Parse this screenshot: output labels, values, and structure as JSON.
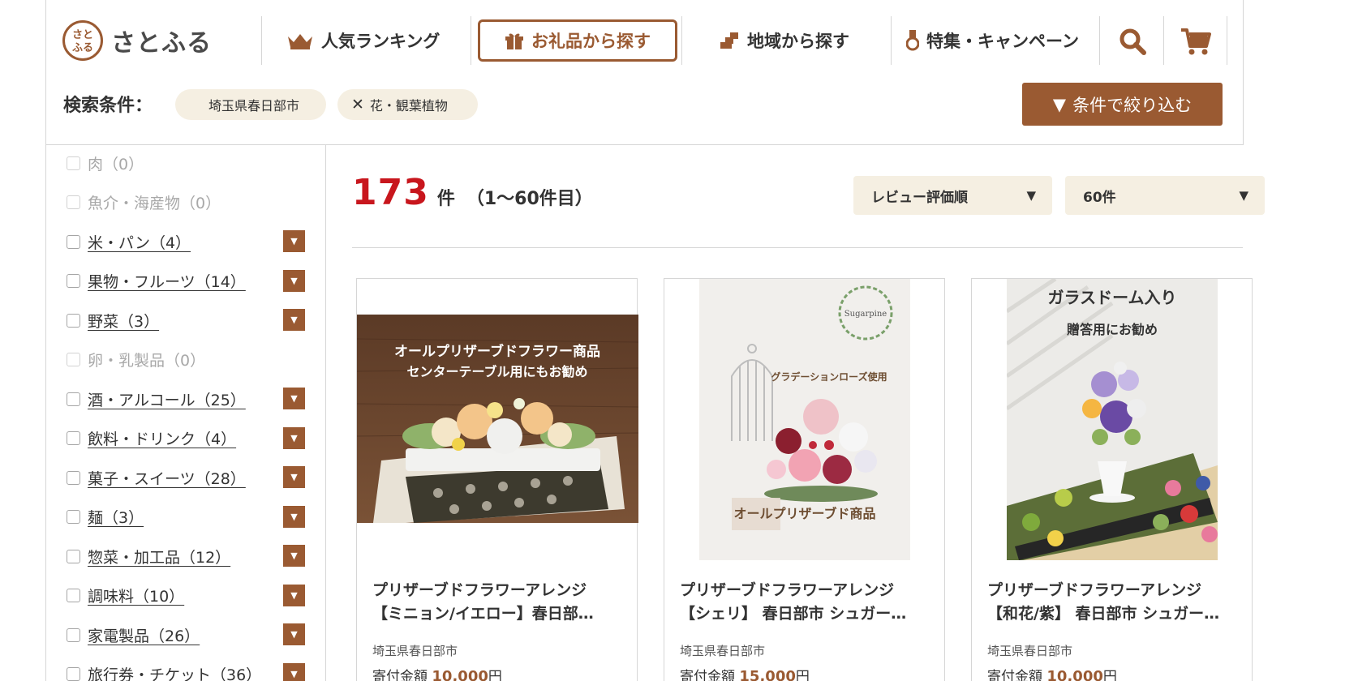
{
  "header": {
    "logo_mark": "さと\nふる",
    "logo_text": "さとふる",
    "nav": [
      {
        "label": "人気ランキング",
        "icon": "crown-icon"
      },
      {
        "label": "お礼品から探す",
        "icon": "gift-icon",
        "active": true
      },
      {
        "label": "地域から探す",
        "icon": "region-map-icon"
      },
      {
        "label": "特集・キャンペーン",
        "icon": "medal-icon"
      }
    ],
    "search_icon": "search-icon",
    "cart_icon": "cart-icon",
    "accent_color": "#9a5a32"
  },
  "conditions": {
    "label": "検索条件：",
    "chips": [
      {
        "label": "埼玉県春日部市",
        "removable": false
      },
      {
        "label": "花・観葉植物",
        "removable": true,
        "remove_glyph": "✕"
      }
    ],
    "filter_button": "条件で絞り込む",
    "filter_button_glyph": "▼"
  },
  "sidebar": {
    "categories": [
      {
        "label": "肉（0）",
        "enabled": false
      },
      {
        "label": "魚介・海産物（0）",
        "enabled": false
      },
      {
        "label": "米・パン（4）",
        "enabled": true
      },
      {
        "label": "果物・フルーツ（14）",
        "enabled": true
      },
      {
        "label": "野菜（3）",
        "enabled": true
      },
      {
        "label": "卵・乳製品（0）",
        "enabled": false
      },
      {
        "label": "酒・アルコール（25）",
        "enabled": true
      },
      {
        "label": "飲料・ドリンク（4）",
        "enabled": true
      },
      {
        "label": "菓子・スイーツ（28）",
        "enabled": true
      },
      {
        "label": "麺（3）",
        "enabled": true
      },
      {
        "label": "惣菜・加工品（12）",
        "enabled": true
      },
      {
        "label": "調味料（10）",
        "enabled": true
      },
      {
        "label": "家電製品（26）",
        "enabled": true
      },
      {
        "label": "旅行券・チケット（36）",
        "enabled": true
      }
    ],
    "toggle_glyph": "▼"
  },
  "results": {
    "count": "173",
    "count_unit": "件",
    "range": "（1～60件目）",
    "sort": {
      "label": "レビュー評価順",
      "arrow": "▼"
    },
    "per_page": {
      "label": "60件",
      "arrow": "▼"
    }
  },
  "products": [
    {
      "image_caption_1": "オールプリザーブドフラワー商品",
      "image_caption_2": "センターテーブル用にもお勧め",
      "title_line1": "プリザーブドフラワーアレンジ",
      "title_line2": "【ミニョン/イエロー】春日部…",
      "region": "埼玉県春日部市",
      "price_label": "寄付金額 ",
      "price_amount": "10,000",
      "price_unit": "円"
    },
    {
      "image_caption_1": "グラデーションローズ使用",
      "image_caption_2": "オールプリザーブド商品",
      "image_logo_text": "Sugarpine",
      "title_line1": "プリザーブドフラワーアレンジ",
      "title_line2": "【シェリ】 春日部市 シュガー…",
      "region": "埼玉県春日部市",
      "price_label": "寄付金額 ",
      "price_amount": "15,000",
      "price_unit": "円"
    },
    {
      "image_caption_1": "ガラスドーム入り",
      "image_caption_2": "贈答用にお勧め",
      "title_line1": "プリザーブドフラワーアレンジ",
      "title_line2": "【和花/紫】 春日部市 シュガー…",
      "region": "埼玉県春日部市",
      "price_label": "寄付金額 ",
      "price_amount": "10,000",
      "price_unit": "円"
    }
  ]
}
